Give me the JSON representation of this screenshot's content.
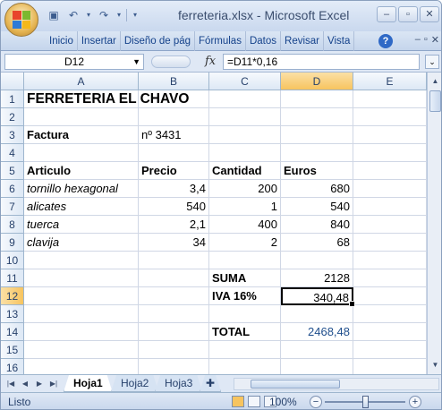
{
  "window": {
    "title": "ferreteria.xlsx - Microsoft Excel",
    "controls": [
      "–",
      "▫",
      "✕"
    ]
  },
  "quick_access": {
    "save_icon": "save-icon",
    "undo_icon": "undo-icon",
    "redo_icon": "redo-icon"
  },
  "ribbon": {
    "tabs": [
      "Inicio",
      "Insertar",
      "Diseño de pág",
      "Fórmulas",
      "Datos",
      "Revisar",
      "Vista"
    ],
    "help": "?",
    "ribbon_controls": [
      "–",
      "▫",
      "✕"
    ]
  },
  "formula_bar": {
    "name_box": "D12",
    "fx": "fx",
    "formula": "=D11*0,16"
  },
  "grid": {
    "columns": [
      "A",
      "B",
      "C",
      "D",
      "E"
    ],
    "rows": [
      "1",
      "2",
      "3",
      "4",
      "5",
      "6",
      "7",
      "8",
      "9",
      "10",
      "11",
      "12",
      "13",
      "14",
      "15",
      "16"
    ],
    "selected_column": "D",
    "selected_row": "12",
    "cells": {
      "A1": "FERRETERIA EL CHAVO",
      "A3": "Factura",
      "B3": "nº 3431",
      "A5": "Articulo",
      "B5": "Precio",
      "C5": "Cantidad",
      "D5": "Euros",
      "A6": "tornillo hexagonal",
      "B6": "3,4",
      "C6": "200",
      "D6": "680",
      "A7": "alicates",
      "B7": "540",
      "C7": "1",
      "D7": "540",
      "A8": "tuerca",
      "B8": "2,1",
      "C8": "400",
      "D8": "840",
      "A9": "clavija",
      "B9": "34",
      "C9": "2",
      "D9": "68",
      "C11": "SUMA",
      "D11": "2128",
      "C12": "IVA 16%",
      "D12": "340,48",
      "C14": "TOTAL",
      "D14": "2468,48"
    }
  },
  "sheets": {
    "tabs": [
      "Hoja1",
      "Hoja2",
      "Hoja3"
    ],
    "active": "Hoja1"
  },
  "status_bar": {
    "ready": "Listo",
    "zoom": "100%",
    "zoom_level_percent": 100
  },
  "colors": {
    "selection_header": "#f7c45f",
    "accent_text": "#1f4e8c",
    "ui_blue": "#15428b"
  }
}
